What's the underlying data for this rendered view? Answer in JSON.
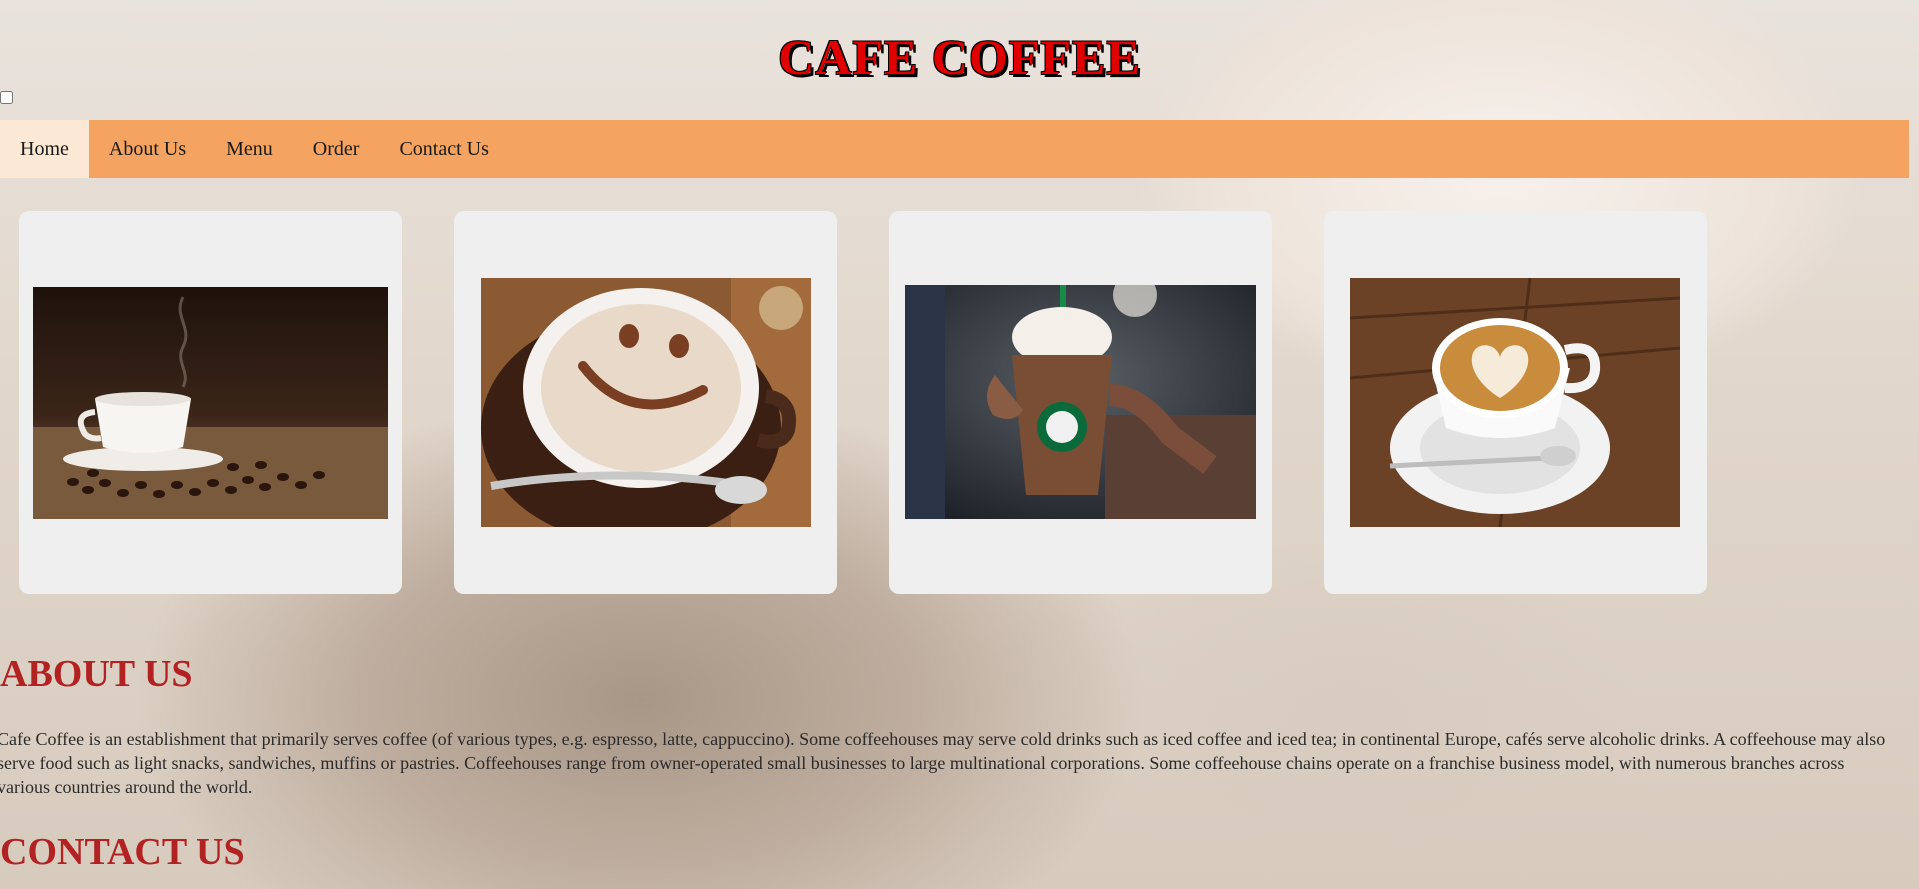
{
  "header": {
    "title": "CAFE COFFEE"
  },
  "nav": {
    "items": [
      {
        "label": "Home",
        "active": true
      },
      {
        "label": "About Us",
        "active": false
      },
      {
        "label": "Menu",
        "active": false
      },
      {
        "label": "Order",
        "active": false
      },
      {
        "label": "Contact Us",
        "active": false
      }
    ]
  },
  "gallery": [
    {
      "subject": "coffee cup with beans"
    },
    {
      "subject": "smiley cappuccino"
    },
    {
      "subject": "starbucks frappuccino"
    },
    {
      "subject": "latte art heart"
    }
  ],
  "about": {
    "heading": "ABOUT US",
    "text": "Cafe Coffee is an establishment that primarily serves coffee (of various types, e.g. espresso, latte, cappuccino). Some coffeehouses may serve cold drinks such as iced coffee and iced tea; in continental Europe, cafés serve alcoholic drinks. A coffeehouse may also serve food such as light snacks, sandwiches, muffins or pastries. Coffeehouses range from owner-operated small businesses to large multinational corporations. Some coffeehouse chains operate on a franchise business model, with numerous branches across various countries around the world."
  },
  "contact": {
    "heading": "CONTACT US"
  },
  "colors": {
    "navbar": "#f4a460",
    "active_tab": "#fbe9d5",
    "heading": "#b22222",
    "title": "#e00000"
  }
}
